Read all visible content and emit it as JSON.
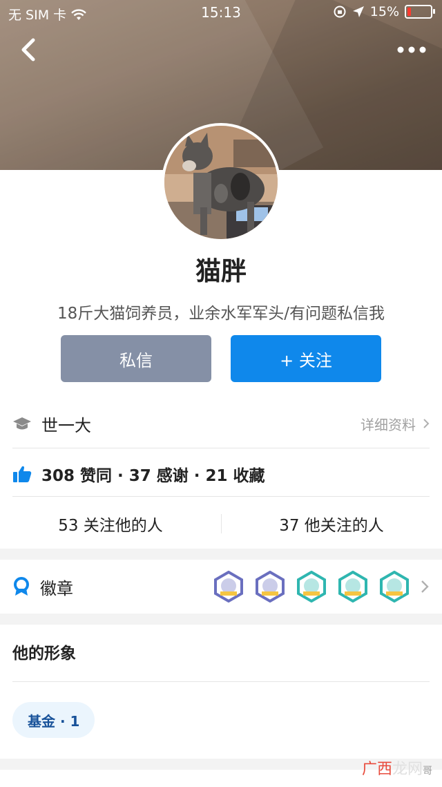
{
  "status_bar": {
    "carrier": "无 SIM 卡",
    "time": "15:13",
    "battery": "15%",
    "battery_level": 0.15
  },
  "profile": {
    "name": "猫胖",
    "bio": "18斤大猫饲养员，业余水军军头/有问题私信我",
    "message_button": "私信",
    "follow_button": "+ 关注"
  },
  "education": {
    "school": "世一大",
    "detail_link": "详细资料"
  },
  "stats": {
    "text": "308 赞同 · 37 感谢 · 21 收藏"
  },
  "follow": {
    "followers": "53 关注他的人",
    "following": "37 他关注的人"
  },
  "badges": {
    "title": "徽章",
    "colors": [
      "#6a6fbf",
      "#6a6fbf",
      "#2fb6b0",
      "#2fb6b0",
      "#2fb6b0"
    ]
  },
  "image_section": {
    "title": "他的形象",
    "tag": "基金 · 1"
  },
  "watermark": {
    "text_red": "广西",
    "text_dark": "龙网",
    "text_small": "哥"
  },
  "colors": {
    "accent": "#0f88eb",
    "message_button": "#8590a6",
    "tag_bg": "#ebf5fd",
    "tag_text": "#175199"
  }
}
